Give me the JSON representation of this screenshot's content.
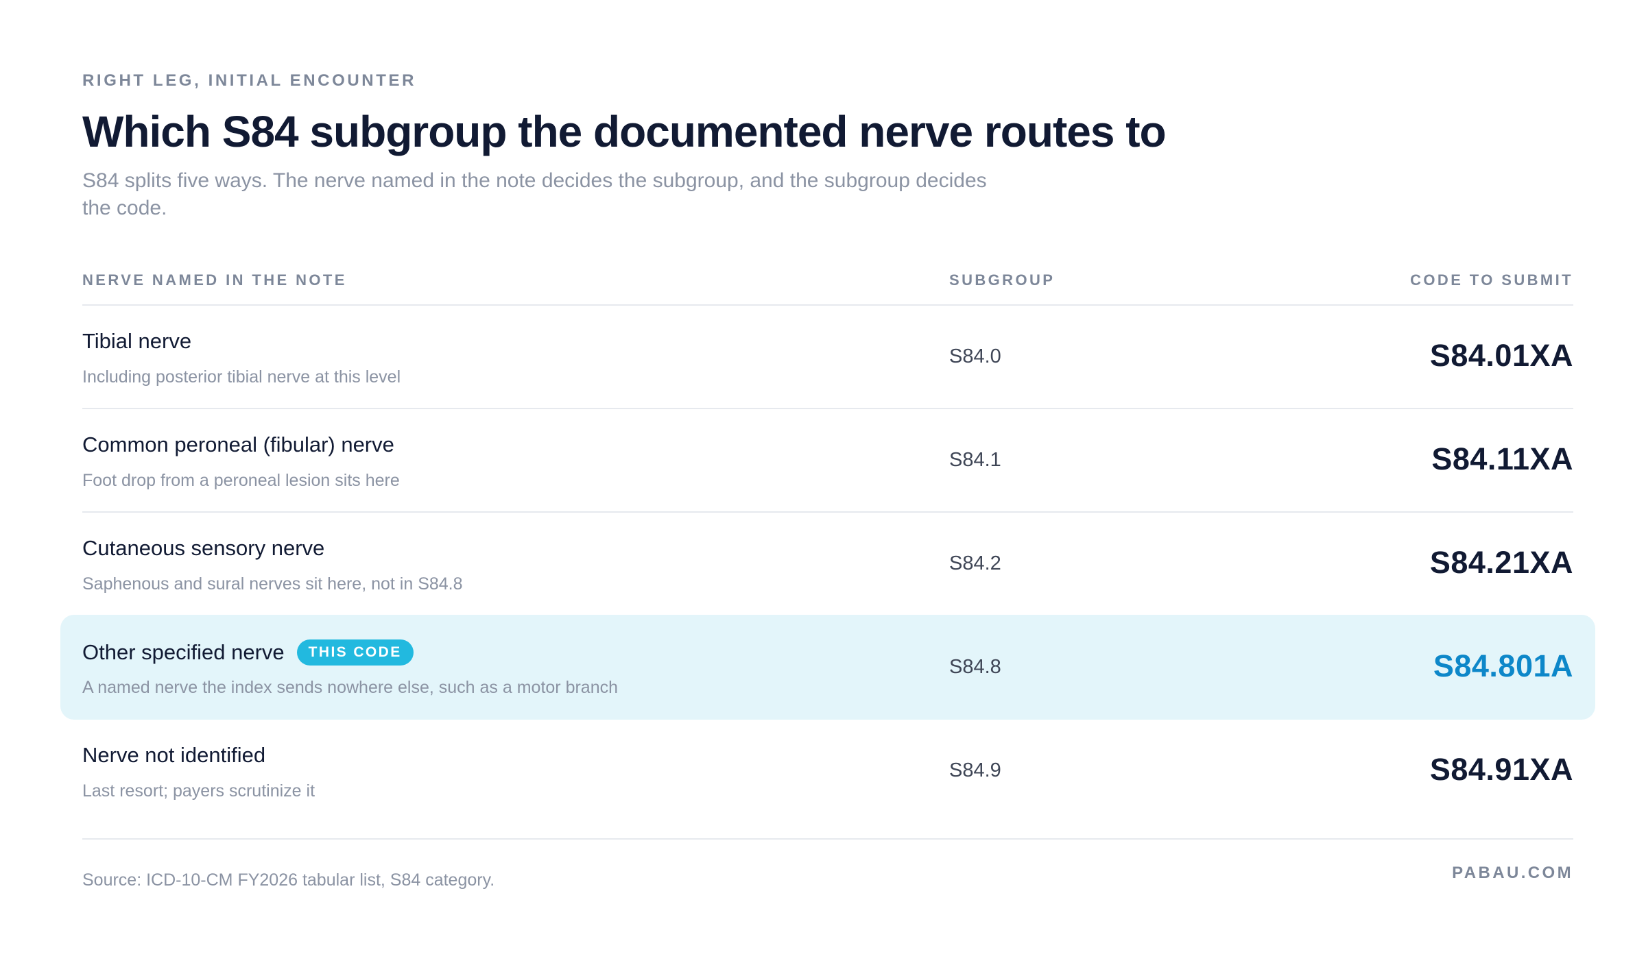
{
  "header": {
    "eyebrow": "RIGHT LEG, INITIAL ENCOUNTER",
    "title": "Which S84 subgroup the documented nerve routes to",
    "subtitle": "S84 splits five ways. The nerve named in the note decides the subgroup, and the subgroup decides the code."
  },
  "table": {
    "columns": {
      "nerve": "NERVE NAMED IN THE NOTE",
      "subgroup": "SUBGROUP",
      "code": "CODE TO SUBMIT"
    },
    "rows": [
      {
        "nerve": "Tibial nerve",
        "note": "Including posterior tibial nerve at this level",
        "subgroup": "S84.0",
        "code": "S84.01XA"
      },
      {
        "nerve": "Common peroneal (fibular) nerve",
        "note": "Foot drop from a peroneal lesion sits here",
        "subgroup": "S84.1",
        "code": "S84.11XA"
      },
      {
        "nerve": "Cutaneous sensory nerve",
        "note": "Saphenous and sural nerves sit here, not in S84.8",
        "subgroup": "S84.2",
        "code": "S84.21XA"
      },
      {
        "nerve": "Other specified nerve",
        "badge": "THIS CODE",
        "note": "A named nerve the index sends nowhere else, such as a motor branch",
        "subgroup": "S84.8",
        "code": "S84.801A"
      },
      {
        "nerve": "Nerve not identified",
        "note": "Last resort; payers scrutinize it",
        "subgroup": "S84.9",
        "code": "S84.91XA"
      }
    ]
  },
  "footer": {
    "source": "Source: ICD-10-CM FY2026 tabular list, S84 category.",
    "brand": "PABAU.COM"
  },
  "colors": {
    "highlight_background": "#e3f5fa",
    "badge": "#22b9df",
    "highlight_code": "#0d87c9",
    "text_dark": "#111a33",
    "text_muted": "#8b93a3"
  }
}
